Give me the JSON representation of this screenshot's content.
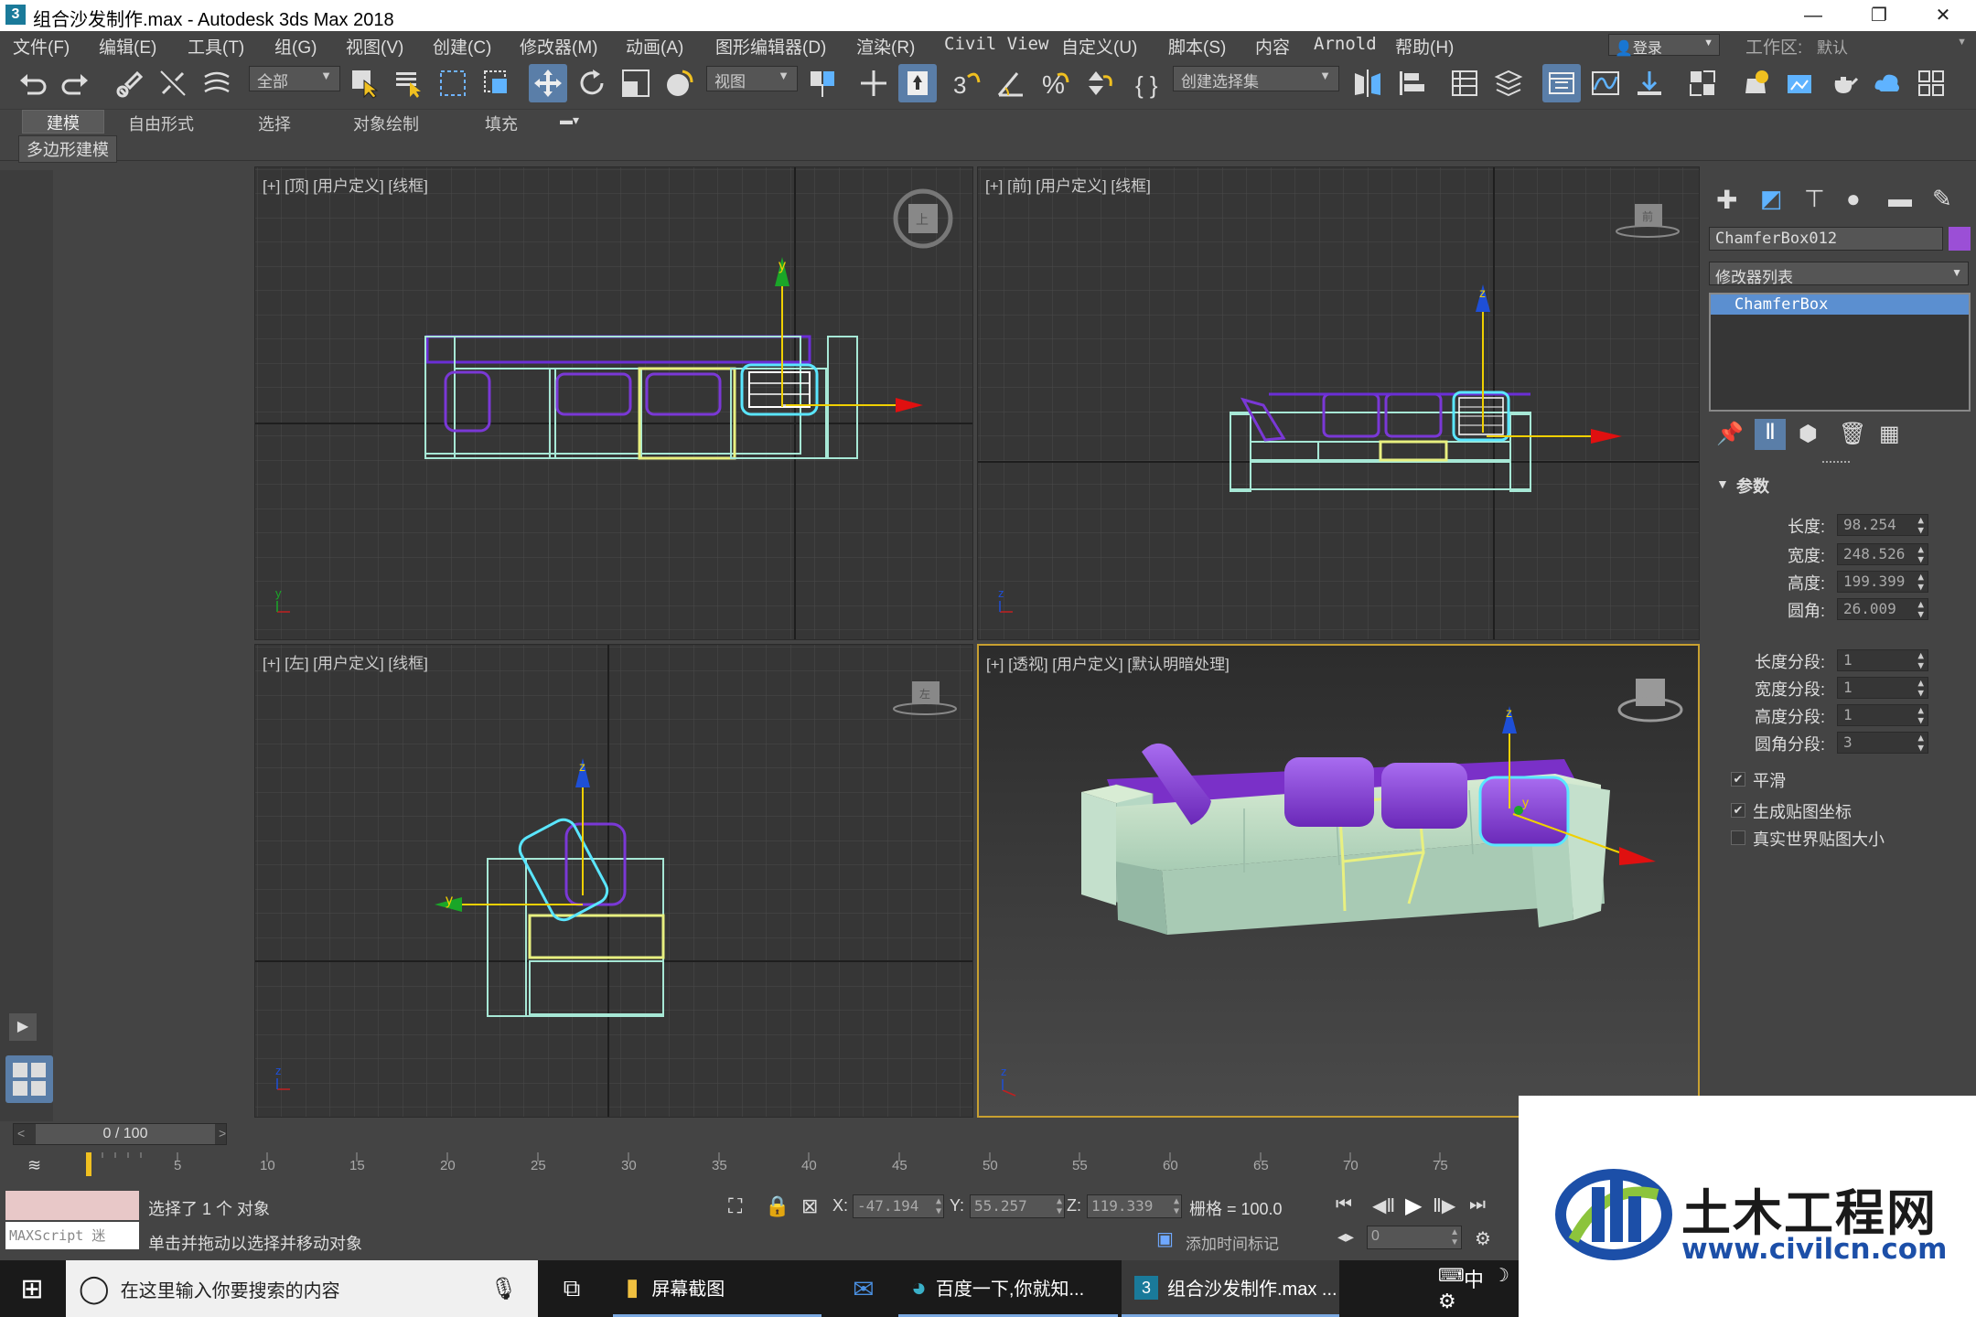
{
  "title": {
    "app_icon_text": "3",
    "text": "组合沙发制作.max - Autodesk 3ds Max 2018",
    "min": "—",
    "restore": "❐",
    "close": "✕"
  },
  "menu": [
    "文件(F)",
    "编辑(E)",
    "工具(T)",
    "组(G)",
    "视图(V)",
    "创建(C)",
    "修改器(M)",
    "动画(A)",
    "图形编辑器(D)",
    "渲染(R)",
    "Civil View",
    "自定义(U)",
    "脚本(S)",
    "内容",
    "Arnold",
    "帮助(H)"
  ],
  "login": {
    "label": "登录",
    "workspace_label": "工作区:",
    "workspace_value": "默认"
  },
  "toolbar": {
    "filter": "全部",
    "refcoord": "视图",
    "selset": "创建选择集"
  },
  "ribbon_tabs": [
    "建模",
    "自由形式",
    "选择",
    "对象绘制",
    "填充"
  ],
  "subribbon": "多边形建模",
  "viewports": {
    "top": "[+] [顶] [用户定义] [线框]",
    "front": "[+] [前] [用户定义] [线框]",
    "left": "[+] [左] [用户定义] [线框]",
    "persp": "[+] [透视] [用户定义] [默认明暗处理]"
  },
  "viewcube": {
    "top": "上",
    "front": "前",
    "left": "左"
  },
  "axis": {
    "x": "x",
    "y": "y",
    "z": "z"
  },
  "cmdpanel": {
    "object_name": "ChamferBox012",
    "modifier_list": "修改器列表",
    "stack_item": "ChamferBox",
    "rollout": "参数",
    "params": [
      {
        "label": "长度:",
        "value": "98.254"
      },
      {
        "label": "宽度:",
        "value": "248.526"
      },
      {
        "label": "高度:",
        "value": "199.399"
      },
      {
        "label": "圆角:",
        "value": "26.009"
      }
    ],
    "segs": [
      {
        "label": "长度分段:",
        "value": "1"
      },
      {
        "label": "宽度分段:",
        "value": "1"
      },
      {
        "label": "高度分段:",
        "value": "1"
      },
      {
        "label": "圆角分段:",
        "value": "3"
      }
    ],
    "checks": [
      {
        "label": "平滑",
        "checked": "✔"
      },
      {
        "label": "生成贴图坐标",
        "checked": "✔"
      },
      {
        "label": "真实世界贴图大小",
        "checked": ""
      }
    ],
    "colors": {
      "object_color": "#9b4fd6",
      "stack_highlight": "#5b8fd0"
    }
  },
  "timeline": {
    "frame": "0 / 100",
    "ticks": [
      "5",
      "10",
      "15",
      "20",
      "25",
      "30",
      "35",
      "40",
      "45",
      "50",
      "55",
      "60",
      "65",
      "70",
      "75"
    ]
  },
  "status": {
    "maxscript": "MAXScript 迷",
    "selected": "选择了 1 个 对象",
    "prompt": "单击并拖动以选择并移动对象",
    "x_label": "X:",
    "x": "-47.194",
    "y_label": "Y:",
    "y": "55.257",
    "z_label": "Z:",
    "z": "119.339",
    "grid": "栅格 = 100.0",
    "addtime": "添加时间标记",
    "frame_field": "0"
  },
  "taskbar": {
    "search": "在这里输入你要搜索的内容",
    "items": [
      "屏幕截图",
      "百度一下,你就知...",
      "组合沙发制作.max ..."
    ],
    "ime": "中"
  },
  "watermark": {
    "name": "土木工程网",
    "url": "www.civilcn.com"
  }
}
